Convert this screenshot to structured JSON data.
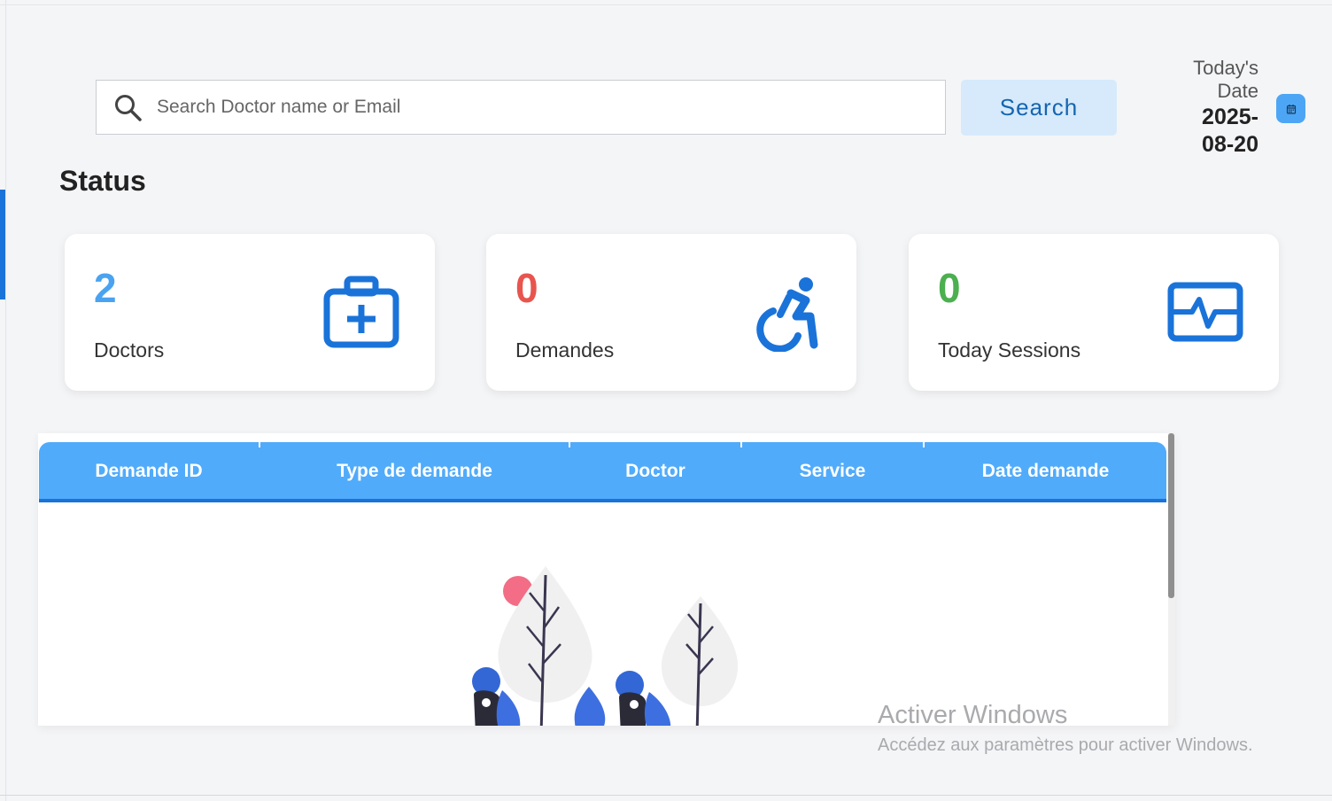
{
  "search": {
    "placeholder": "Search Doctor name or Email",
    "button_label": "Search"
  },
  "date": {
    "label": "Today's Date",
    "value": "2025-08-20"
  },
  "status": {
    "title": "Status",
    "cards": [
      {
        "value": "2",
        "label": "Doctors",
        "icon": "medical-kit-icon",
        "color": "#4aa3f0"
      },
      {
        "value": "0",
        "label": "Demandes",
        "icon": "wheelchair-icon",
        "color": "#e8554e"
      },
      {
        "value": "0",
        "label": "Today Sessions",
        "icon": "heart-monitor-icon",
        "color": "#4caf50"
      }
    ]
  },
  "table": {
    "columns": [
      "Demande ID",
      "Type de demande",
      "Doctor",
      "Service",
      "Date demande"
    ],
    "rows": []
  },
  "watermark": {
    "title": "Activer Windows",
    "subtitle": "Accédez aux paramètres pour activer Windows."
  },
  "colors": {
    "accent": "#1a73d9",
    "table_header": "#50abfb",
    "search_button_bg": "#d6eafb"
  }
}
